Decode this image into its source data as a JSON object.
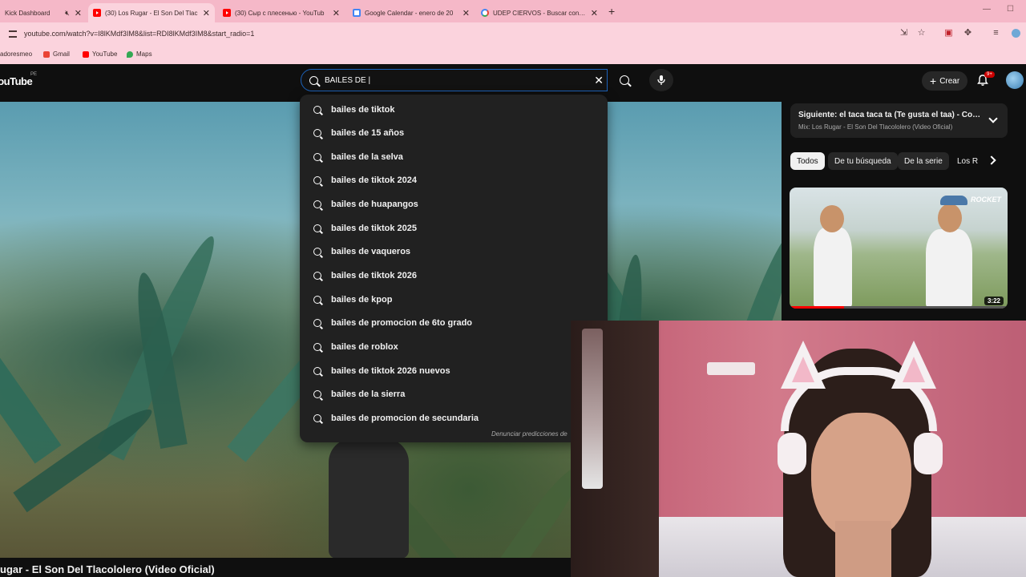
{
  "browser": {
    "tabs": [
      {
        "title": "Kick Dashboard",
        "favicon": "kick-icon",
        "muted": true
      },
      {
        "title": "(30) Los Rugar - El Son Del Tlac",
        "favicon": "youtube-icon",
        "active": true
      },
      {
        "title": "(30) Сыр с плесенью - YouTub",
        "favicon": "youtube-icon"
      },
      {
        "title": "Google Calendar - enero de 20",
        "favicon": "calendar-icon"
      },
      {
        "title": "UDEP CIERVOS - Buscar con Go",
        "favicon": "google-icon"
      }
    ],
    "url": "youtube.com/watch?v=I8lKMdf3IM8&list=RDI8lKMdf3IM8&start_radio=1",
    "bookmarks": [
      "adoresmeo",
      "Gmail",
      "YouTube",
      "Maps"
    ]
  },
  "youtube": {
    "logo": "YouTube",
    "region": "PE",
    "search": {
      "value": "BAILES DE |",
      "suggestions": [
        "bailes de tiktok",
        "bailes de 15 años",
        "bailes de la selva",
        "bailes de tiktok 2024",
        "bailes de huapangos",
        "bailes de tiktok 2025",
        "bailes de vaqueros",
        "bailes de tiktok 2026",
        "bailes de kpop",
        "bailes de promocion de 6to grado",
        "bailes de roblox",
        "bailes de tiktok 2026 nuevos",
        "bailes de la sierra",
        "bailes de promocion de secundaria"
      ],
      "report_link": "Denunciar predicciones de"
    },
    "create_label": "Crear",
    "notifications_badge": "9+",
    "video_title": "ugar - El Son Del Tlacololero (Video Oficial)",
    "up_next": {
      "title": "Siguiente: el taca taca ta (Te gusta el taa) - Conjunt...",
      "subtitle": "Mix: Los Rugar - El Son Del Tlacololero (Video Oficial)"
    },
    "chips": [
      "Todos",
      "De tu búsqueda",
      "De la serie",
      "Los R"
    ],
    "thumbnail": {
      "duration": "3:22",
      "brand": "ROCKET",
      "progress": 0.25
    }
  },
  "colors": {
    "tab_bar": "#f5b8c8",
    "toolbar": "#fbd3dd",
    "youtube_bg": "#0f0f0f",
    "focus_border": "#1c62b9"
  }
}
